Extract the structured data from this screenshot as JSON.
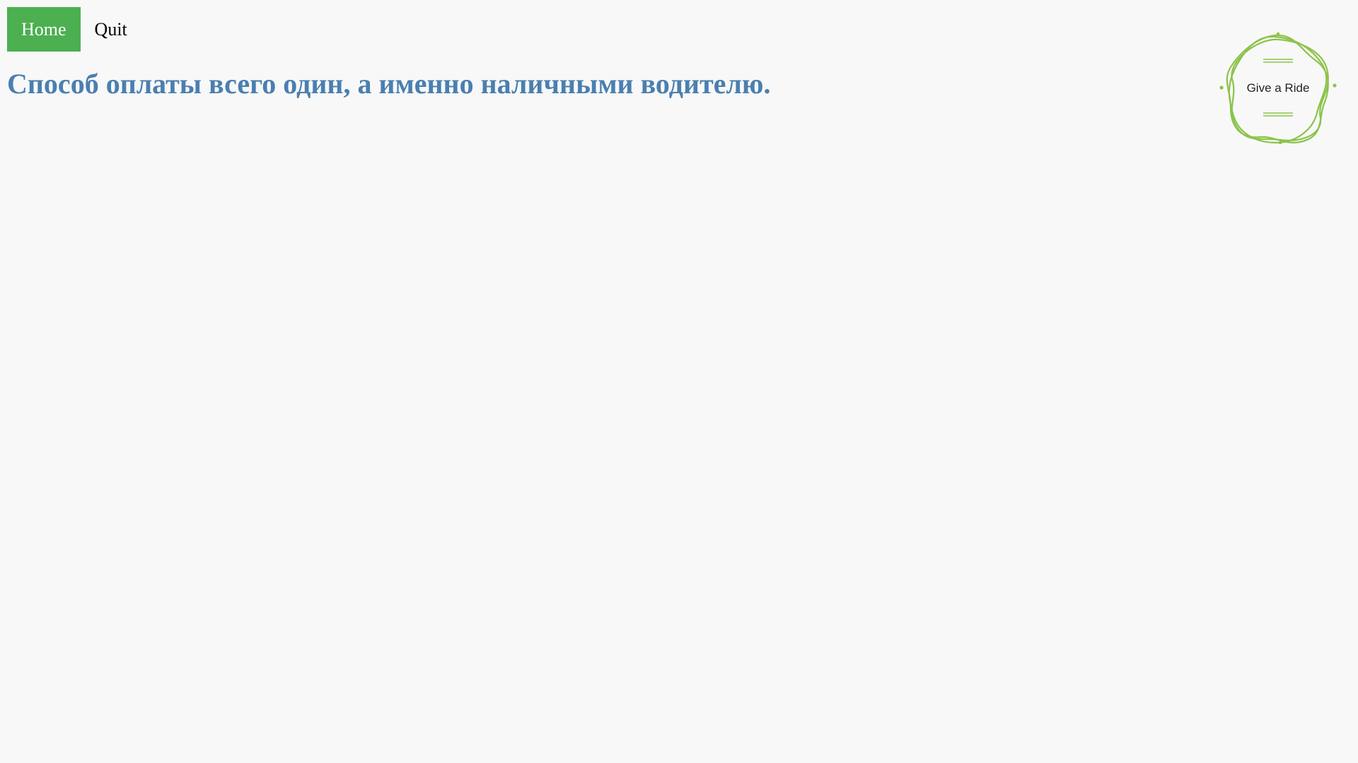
{
  "nav": {
    "items": [
      {
        "label": "Home",
        "active": true
      },
      {
        "label": "Quit",
        "active": false
      }
    ]
  },
  "main": {
    "headline": "Способ оплаты всего один, а именно наличными водителю."
  },
  "logo": {
    "text": "Give a Ride",
    "color": "#8bc34a"
  },
  "colors": {
    "accent": "#4caf50",
    "headline": "#4a7fb0",
    "background": "#f8f8f8"
  }
}
